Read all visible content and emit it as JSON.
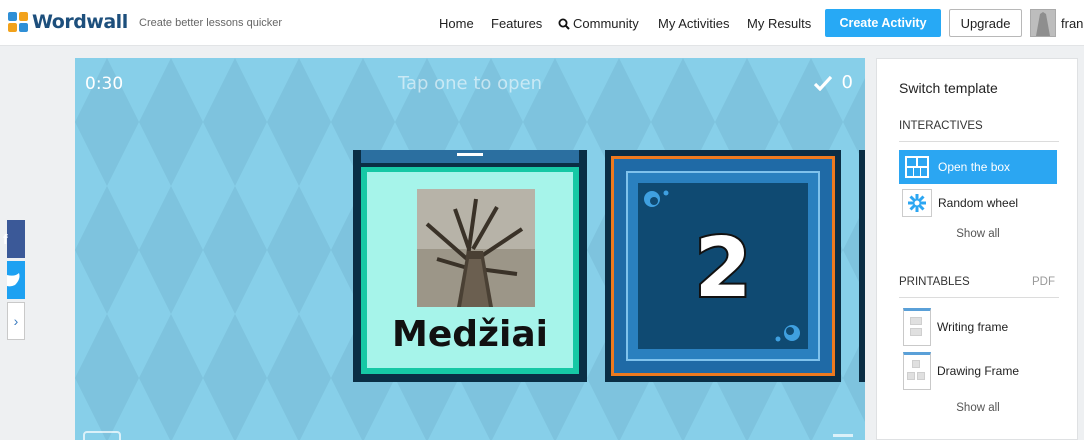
{
  "header": {
    "logo_text": "Wordwall",
    "tagline": "Create better lessons quicker",
    "nav": [
      "Home",
      "Features",
      "Community",
      "My Activities",
      "My Results"
    ],
    "create_label": "Create Activity",
    "upgrade_label": "Upgrade",
    "user_name": "fran"
  },
  "game": {
    "timer": "0:30",
    "hint": "Tap one to open",
    "score": "0",
    "open_card_word": "Medžiai",
    "closed_card_number": "2"
  },
  "share": {
    "more_glyph": "›"
  },
  "sidebar": {
    "title": "Switch template",
    "interactives_heading": "INTERACTIVES",
    "interactives": [
      {
        "label": "Open the box",
        "icon": "open-box-icon",
        "active": true
      },
      {
        "label": "Random wheel",
        "icon": "random-wheel-icon",
        "active": false
      }
    ],
    "interactives_show_all": "Show all",
    "printables_heading": "PRINTABLES",
    "pdf_label": "PDF",
    "printables": [
      {
        "label": "Writing frame",
        "icon": "writing-frame-icon"
      },
      {
        "label": "Drawing Frame",
        "icon": "drawing-frame-icon"
      }
    ],
    "printables_show_all": "Show all"
  },
  "colors": {
    "accent": "#27a9f5",
    "game_background": "#87cfe9",
    "card_frame": "#0a2e45",
    "card_open_face": "#a6f4ea",
    "card_closed_border": "#ee7a1e"
  }
}
